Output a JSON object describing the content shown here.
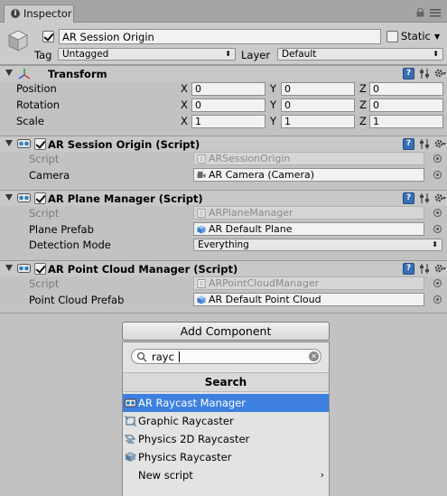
{
  "tab": {
    "label": "Inspector"
  },
  "object": {
    "name": "AR Session Origin",
    "static_label": "Static",
    "tag_label": "Tag",
    "tag_value": "Untagged",
    "layer_label": "Layer",
    "layer_value": "Default"
  },
  "transform": {
    "title": "Transform",
    "rows": [
      {
        "label": "Position",
        "x": "0",
        "y": "0",
        "z": "0"
      },
      {
        "label": "Rotation",
        "x": "0",
        "y": "0",
        "z": "0"
      },
      {
        "label": "Scale",
        "x": "1",
        "y": "1",
        "z": "1"
      }
    ],
    "axis_x": "X",
    "axis_y": "Y",
    "axis_z": "Z"
  },
  "components": [
    {
      "title": "AR Session Origin (Script)",
      "script_label": "Script",
      "script_value": "ARSessionOrigin",
      "field_label": "Camera",
      "field_value": "AR Camera (Camera)"
    },
    {
      "title": "AR Plane Manager (Script)",
      "script_label": "Script",
      "script_value": "ARPlaneManager",
      "field_label": "Plane Prefab",
      "field_value": "AR Default Plane",
      "mode_label": "Detection Mode",
      "mode_value": "Everything"
    },
    {
      "title": "AR Point Cloud Manager (Script)",
      "script_label": "Script",
      "script_value": "ARPointCloudManager",
      "field_label": "Point Cloud Prefab",
      "field_value": "AR Default Point Cloud"
    }
  ],
  "add_component": {
    "button_label": "Add Component",
    "search_value": "rayc",
    "popup_title": "Search",
    "results": [
      {
        "label": "AR Raycast Manager",
        "icon": "script-icon"
      },
      {
        "label": "Graphic Raycaster",
        "icon": "component-icon"
      },
      {
        "label": "Physics 2D Raycaster",
        "icon": "physics2d-icon"
      },
      {
        "label": "Physics Raycaster",
        "icon": "physics-icon"
      },
      {
        "label": "New script",
        "icon": ""
      }
    ],
    "new_script_arrow": "›"
  },
  "colors": {
    "panel": "#c2c2c2",
    "selection": "#3d80df"
  }
}
